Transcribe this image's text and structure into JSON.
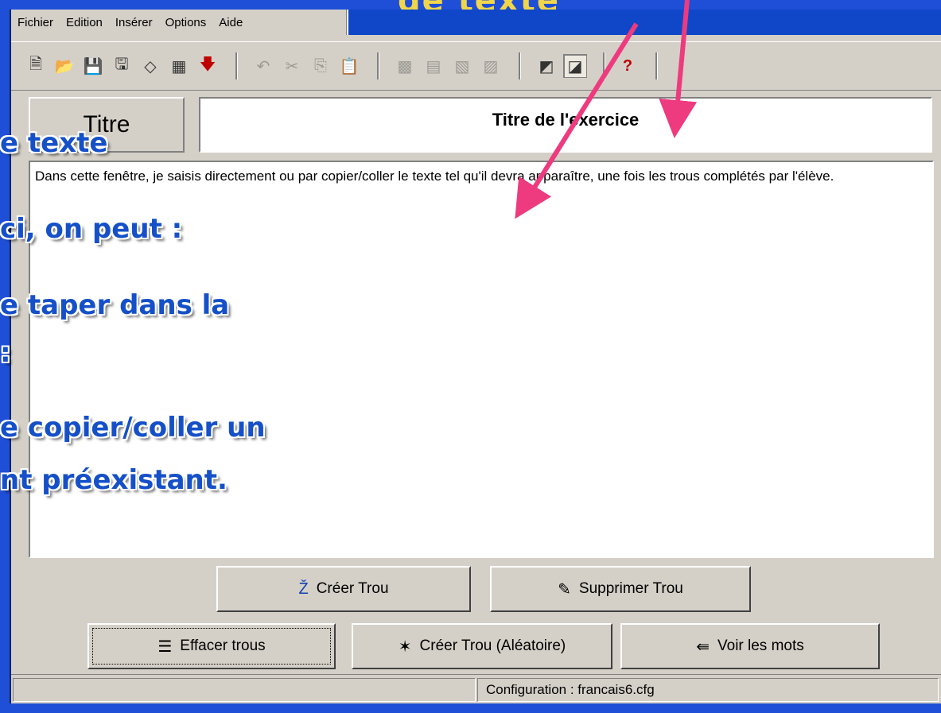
{
  "slide_heading": "de texte",
  "menu": [
    "Fichier",
    "Edition",
    "Insérer",
    "Options",
    "Aide"
  ],
  "toolbar": {
    "icons": [
      "new-document-icon",
      "open-folder-icon",
      "save-icon",
      "save-as-icon",
      "eraser-icon",
      "web-export-icon",
      "download-arrow-icon",
      "undo-icon",
      "cut-icon",
      "copy-icon",
      "paste-icon",
      "hole-create-icon",
      "hole-layout-icon",
      "hole-random-icon",
      "hole-remove-icon",
      "preview-icon",
      "edit-mode-icon",
      "help-icon"
    ]
  },
  "title_label": "Titre",
  "title_value": "Titre de l'exercice",
  "text_content": "Dans cette fenêtre, je saisis directement ou par copier/coller le texte tel qu'il devra apparaître, une fois les trous complétés par l'élève.",
  "buttons": {
    "create_hole": "Créer Trou",
    "delete_hole": "Supprimer Trou",
    "clear_holes": "Effacer trous",
    "create_random": "Créer Trou (Aléatoire)",
    "see_words": "Voir les mots"
  },
  "status": "Configuration : francais6.cfg",
  "overlay_lines": [
    "e texte",
    "ci, on peut :",
    "e taper  dans la",
    ":",
    "e copier/coller un",
    "nt préexistant."
  ],
  "colors": {
    "background": "#1f4fd6",
    "window": "#d4d0c8",
    "overlay_text": "#1550c8",
    "arrow": "#ee3a7e"
  }
}
